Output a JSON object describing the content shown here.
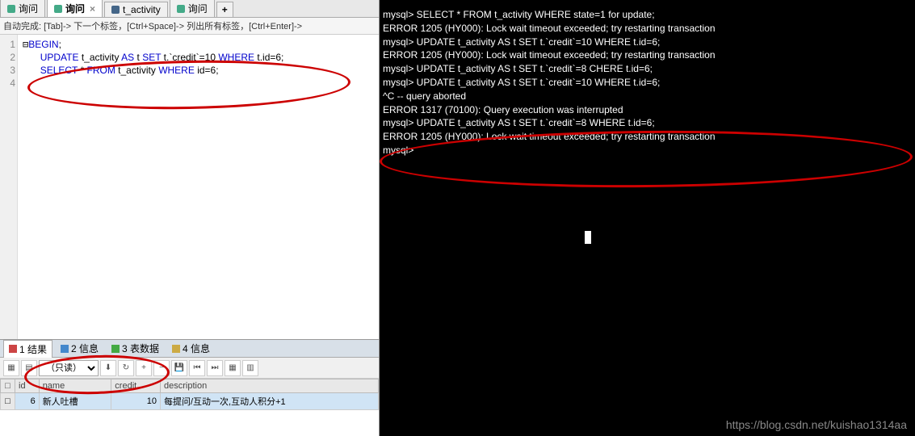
{
  "tabs": [
    {
      "label": "询问",
      "active": false
    },
    {
      "label": "询问",
      "active": true
    },
    {
      "label": "t_activity",
      "active": false
    },
    {
      "label": "询问",
      "active": false
    }
  ],
  "tab_add": "+",
  "editor_hint": "自动完成: [Tab]-> 下一个标签，[Ctrl+Space]-> 列出所有标签，[Ctrl+Enter]->",
  "gutter": [
    "1",
    "2",
    "3",
    "4"
  ],
  "sql": {
    "l1_kw": "BEGIN",
    "l1_end": ";",
    "l2_kw1": "UPDATE",
    "l2_t1": " t_activity ",
    "l2_kw2": "AS",
    "l2_t2": " t ",
    "l2_kw3": "SET",
    "l2_t3": " t.`credit`=10 ",
    "l2_kw4": "WHERE",
    "l2_t4": " t.id=6;",
    "l3_kw1": "SELECT",
    "l3_t1": " * ",
    "l3_kw2": "FROM",
    "l3_t2": " t_activity ",
    "l3_kw3": "WHERE",
    "l3_t3": " id=6;"
  },
  "bottom_tabs": [
    {
      "label": "1 结果",
      "active": true
    },
    {
      "label": "2 信息",
      "active": false
    },
    {
      "label": "3 表数据",
      "active": false
    },
    {
      "label": "4 信息",
      "active": false
    }
  ],
  "readonly_label": "（只读）",
  "grid": {
    "headers": [
      "id",
      "name",
      "credit",
      "description"
    ],
    "row": {
      "id": "6",
      "name": "新人吐槽",
      "credit": "10",
      "description": "每提问/互动一次,互动人积分+1"
    }
  },
  "terminal": [
    "mysql> SELECT * FROM t_activity WHERE state=1 for update;",
    "ERROR 1205 (HY000): Lock wait timeout exceeded; try restarting transaction",
    "mysql> UPDATE t_activity AS t SET t.`credit`=10 WHERE t.id=6;",
    "ERROR 1205 (HY000): Lock wait timeout exceeded; try restarting transaction",
    "mysql> UPDATE t_activity AS t SET t.`credit`=8 CHERE t.id=6;",
    "mysql> UPDATE t_activity AS t SET t.`credit`=10 WHERE t.id=6;",
    "^C -- query aborted",
    "ERROR 1317 (70100): Query execution was interrupted",
    "mysql> UPDATE t_activity AS t SET t.`credit`=8 WHERE t.id=6;",
    "ERROR 1205 (HY000): Lock wait timeout exceeded; try restarting transaction",
    "mysql>"
  ],
  "watermark": "https://blog.csdn.net/kuishao1314aa"
}
